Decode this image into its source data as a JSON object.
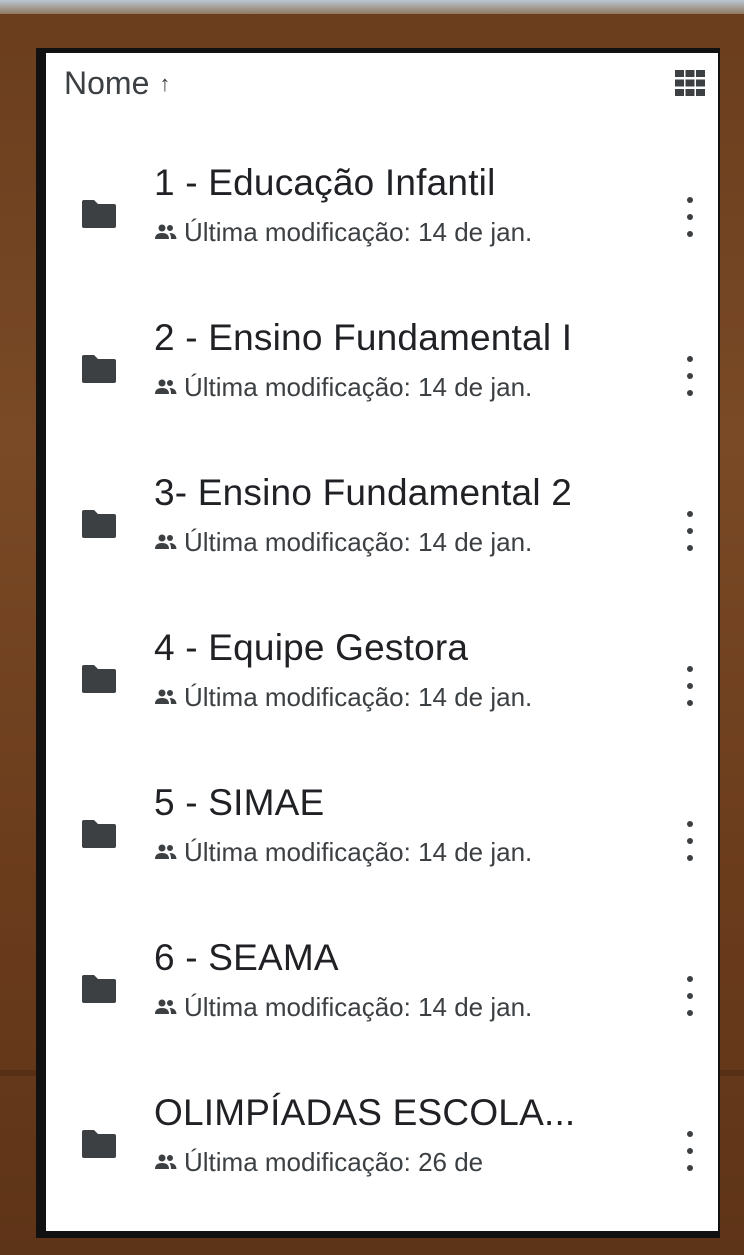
{
  "header": {
    "sort_label": "Nome",
    "sort_arrow": "↑",
    "sort_icon": "arrow-up-icon",
    "view_toggle_icon": "grid-view-icon"
  },
  "items": [
    {
      "title": "1 - Educação Infantil",
      "subtitle": "Última modificação: 14 de jan.",
      "icon": "folder-icon",
      "shared_icon": "shared-people-icon"
    },
    {
      "title": "2 - Ensino Fundamental I",
      "subtitle": "Última modificação: 14 de jan.",
      "icon": "folder-icon",
      "shared_icon": "shared-people-icon"
    },
    {
      "title": "3- Ensino Fundamental 2",
      "subtitle": "Última modificação: 14 de jan.",
      "icon": "folder-icon",
      "shared_icon": "shared-people-icon"
    },
    {
      "title": "4 - Equipe Gestora",
      "subtitle": "Última modificação: 14 de jan.",
      "icon": "folder-icon",
      "shared_icon": "shared-people-icon"
    },
    {
      "title": "5 - SIMAE",
      "subtitle": "Última modificação: 14 de jan.",
      "icon": "folder-icon",
      "shared_icon": "shared-people-icon"
    },
    {
      "title": "6 - SEAMA",
      "subtitle": "Última modificação: 14 de jan.",
      "icon": "folder-icon",
      "shared_icon": "shared-people-icon"
    },
    {
      "title": "OLIMPÍADAS ESCOLA...",
      "subtitle": "Última modificação: 26 de",
      "icon": "folder-icon",
      "shared_icon": "shared-people-icon"
    }
  ],
  "colors": {
    "frame_wood": "#6a3d1d",
    "screen_bg": "#ffffff",
    "text_primary": "#202124",
    "text_secondary": "#3c4043",
    "icon_dark": "#3c4043"
  }
}
